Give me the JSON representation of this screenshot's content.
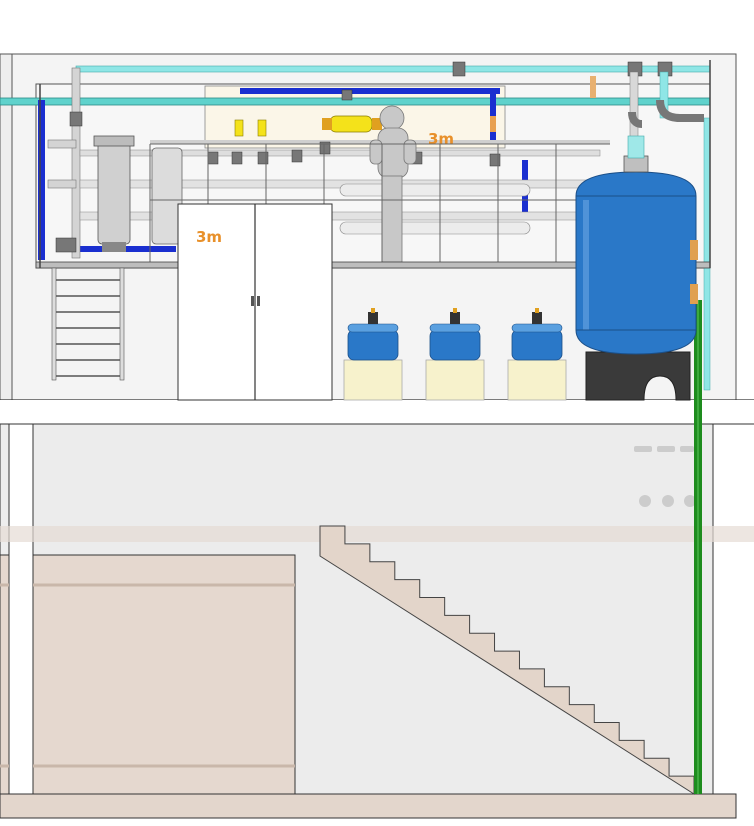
{
  "logos": {
    "skid_logo": "3m",
    "cabinet_logo": "3m"
  },
  "colors": {
    "frame": "#444444",
    "cyan_pipe": "#8fe6e6",
    "blue_pipe": "#1a2fd0",
    "yellow_filter": "#f4e21a",
    "tank_blue": "#2a78c8",
    "tank_base": "#3a3a3a",
    "green_pipe": "#1e8c1e",
    "floor_tan": "#e3d6cc",
    "tank_cream": "#f7f2cc",
    "logo_orange": "#e8902a"
  },
  "components": {
    "dosing_tanks": 3,
    "stair_steps": 15
  }
}
